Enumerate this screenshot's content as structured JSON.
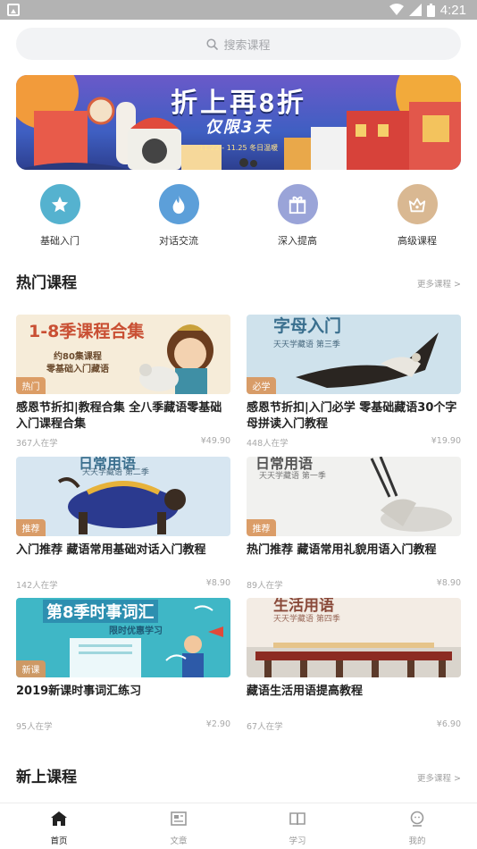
{
  "status_bar": {
    "time": "4:21"
  },
  "search": {
    "placeholder": "搜索课程"
  },
  "banner": {
    "title": "折上再8折",
    "subtitle": "仅限3天",
    "date": "11.22 - 11.25  冬日温暖"
  },
  "categories": [
    {
      "label": "基础入门",
      "icon": "star-icon",
      "color": "#55b2cf"
    },
    {
      "label": "对话交流",
      "icon": "flame-icon",
      "color": "#5c9fd9"
    },
    {
      "label": "深入提高",
      "icon": "gift-icon",
      "color": "#9aa4d8"
    },
    {
      "label": "高级课程",
      "icon": "crown-icon",
      "color": "#d9b892"
    }
  ],
  "hot_section": {
    "title": "热门课程",
    "more": "更多课程 >"
  },
  "courses": [
    {
      "tag": "热门",
      "title": "感恩节折扣|教程合集 全八季藏语零基础入门课程合集",
      "students": "367人在学",
      "price": "¥49.90",
      "thumb_title": "1-8季课程合集",
      "thumb_sub1": "约80集课程",
      "thumb_sub2": "零基础入门藏语"
    },
    {
      "tag": "必学",
      "title": "感恩节折扣|入门必学 零基础藏语30个字母拼读入门教程",
      "students": "448人在学",
      "price": "¥19.90",
      "thumb_title": "字母入门",
      "thumb_sub1": "天天学藏语 第三季"
    },
    {
      "tag": "推荐",
      "title": "入门推荐 藏语常用基础对话入门教程",
      "students": "142人在学",
      "price": "¥8.90",
      "thumb_title": "日常用语",
      "thumb_sub1": "天天学藏语 第二季"
    },
    {
      "tag": "推荐",
      "title": "热门推荐 藏语常用礼貌用语入门教程",
      "students": "89人在学",
      "price": "¥8.90",
      "thumb_title": "日常用语",
      "thumb_sub1": "天天学藏语 第一季"
    },
    {
      "tag": "新课",
      "title": "2019新课时事词汇练习",
      "students": "95人在学",
      "price": "¥2.90",
      "thumb_title": "第8季时事词汇",
      "thumb_sub1": "限时优惠学习"
    },
    {
      "tag": "",
      "title": "藏语生活用语提高教程",
      "students": "67人在学",
      "price": "¥6.90",
      "thumb_title": "生活用语",
      "thumb_sub1": "天天学藏语 第四季"
    }
  ],
  "new_section": {
    "title": "新上课程",
    "more": "更多课程 >"
  },
  "tabs": [
    {
      "label": "首页",
      "icon": "home-icon",
      "active": true
    },
    {
      "label": "文章",
      "icon": "article-icon",
      "active": false
    },
    {
      "label": "学习",
      "icon": "book-icon",
      "active": false
    },
    {
      "label": "我的",
      "icon": "profile-icon",
      "active": false
    }
  ]
}
